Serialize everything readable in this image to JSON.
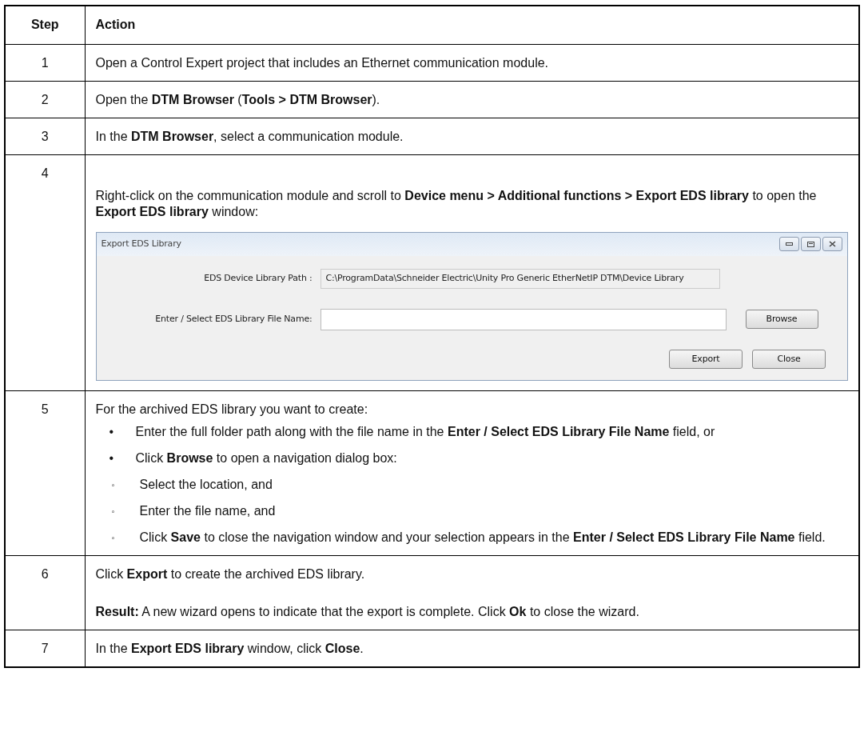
{
  "table": {
    "columns": [
      "Step",
      "Action"
    ],
    "rows": [
      {
        "step": "1",
        "blocks": [
          {
            "kind": "paragraph",
            "text": "Open a Control Expert project that includes an Ethernet communication module."
          }
        ]
      },
      {
        "step": "2",
        "blocks": [
          {
            "kind": "paragraph",
            "text": "Open the **DTM Browser** (**Tools > DTM Browser**)."
          }
        ]
      },
      {
        "step": "3",
        "blocks": [
          {
            "kind": "paragraph",
            "text": "In the **DTM Browser**, select a communication module."
          }
        ]
      },
      {
        "step": "4",
        "blocks": [
          {
            "kind": "paragraph",
            "text": "Right-click on the communication module and scroll to **Device menu > Additional functions > Export EDS library** to open the **Export EDS library** window:"
          },
          {
            "kind": "dialog",
            "title": "Export EDS Library",
            "path_label": "EDS Device Library Path :",
            "path_value": "C:\\ProgramData\\Schneider Electric\\Unity Pro Generic EtherNetIP DTM\\Device Library",
            "file_label": "Enter / Select EDS Library File Name:",
            "browse": "Browse",
            "export": "Export",
            "close": "Close"
          }
        ]
      },
      {
        "step": "5",
        "blocks": [
          {
            "kind": "paragraph",
            "text": "For the archived EDS library you want to create:"
          },
          {
            "kind": "list",
            "items": [
              {
                "bullet": "•",
                "text": "Enter the full folder path along with the file name in the **Enter / Select EDS Library File Name** field, or"
              },
              {
                "bullet": "•",
                "text": "Click **Browse** to open a navigation dialog box:",
                "children": [
                  {
                    "bullet": "◦",
                    "text": "Select the location, and"
                  },
                  {
                    "bullet": "◦",
                    "text": "Enter the file name, and"
                  },
                  {
                    "bullet": "◦",
                    "text": "Click **Save** to close the navigation window and your selection appears in the **Enter / Select EDS Library File Name** field."
                  }
                ]
              }
            ]
          }
        ]
      },
      {
        "step": "6",
        "blocks": [
          {
            "kind": "paragraph",
            "text": "Click **Export** to create the archived EDS library."
          },
          {
            "kind": "paragraph",
            "text": "**Result:** A new wizard opens to indicate that the export is complete. Click **Ok** to close the wizard."
          }
        ]
      },
      {
        "step": "7",
        "blocks": [
          {
            "kind": "paragraph",
            "text": "In the **Export EDS library** window, click **Close**."
          }
        ]
      }
    ]
  }
}
